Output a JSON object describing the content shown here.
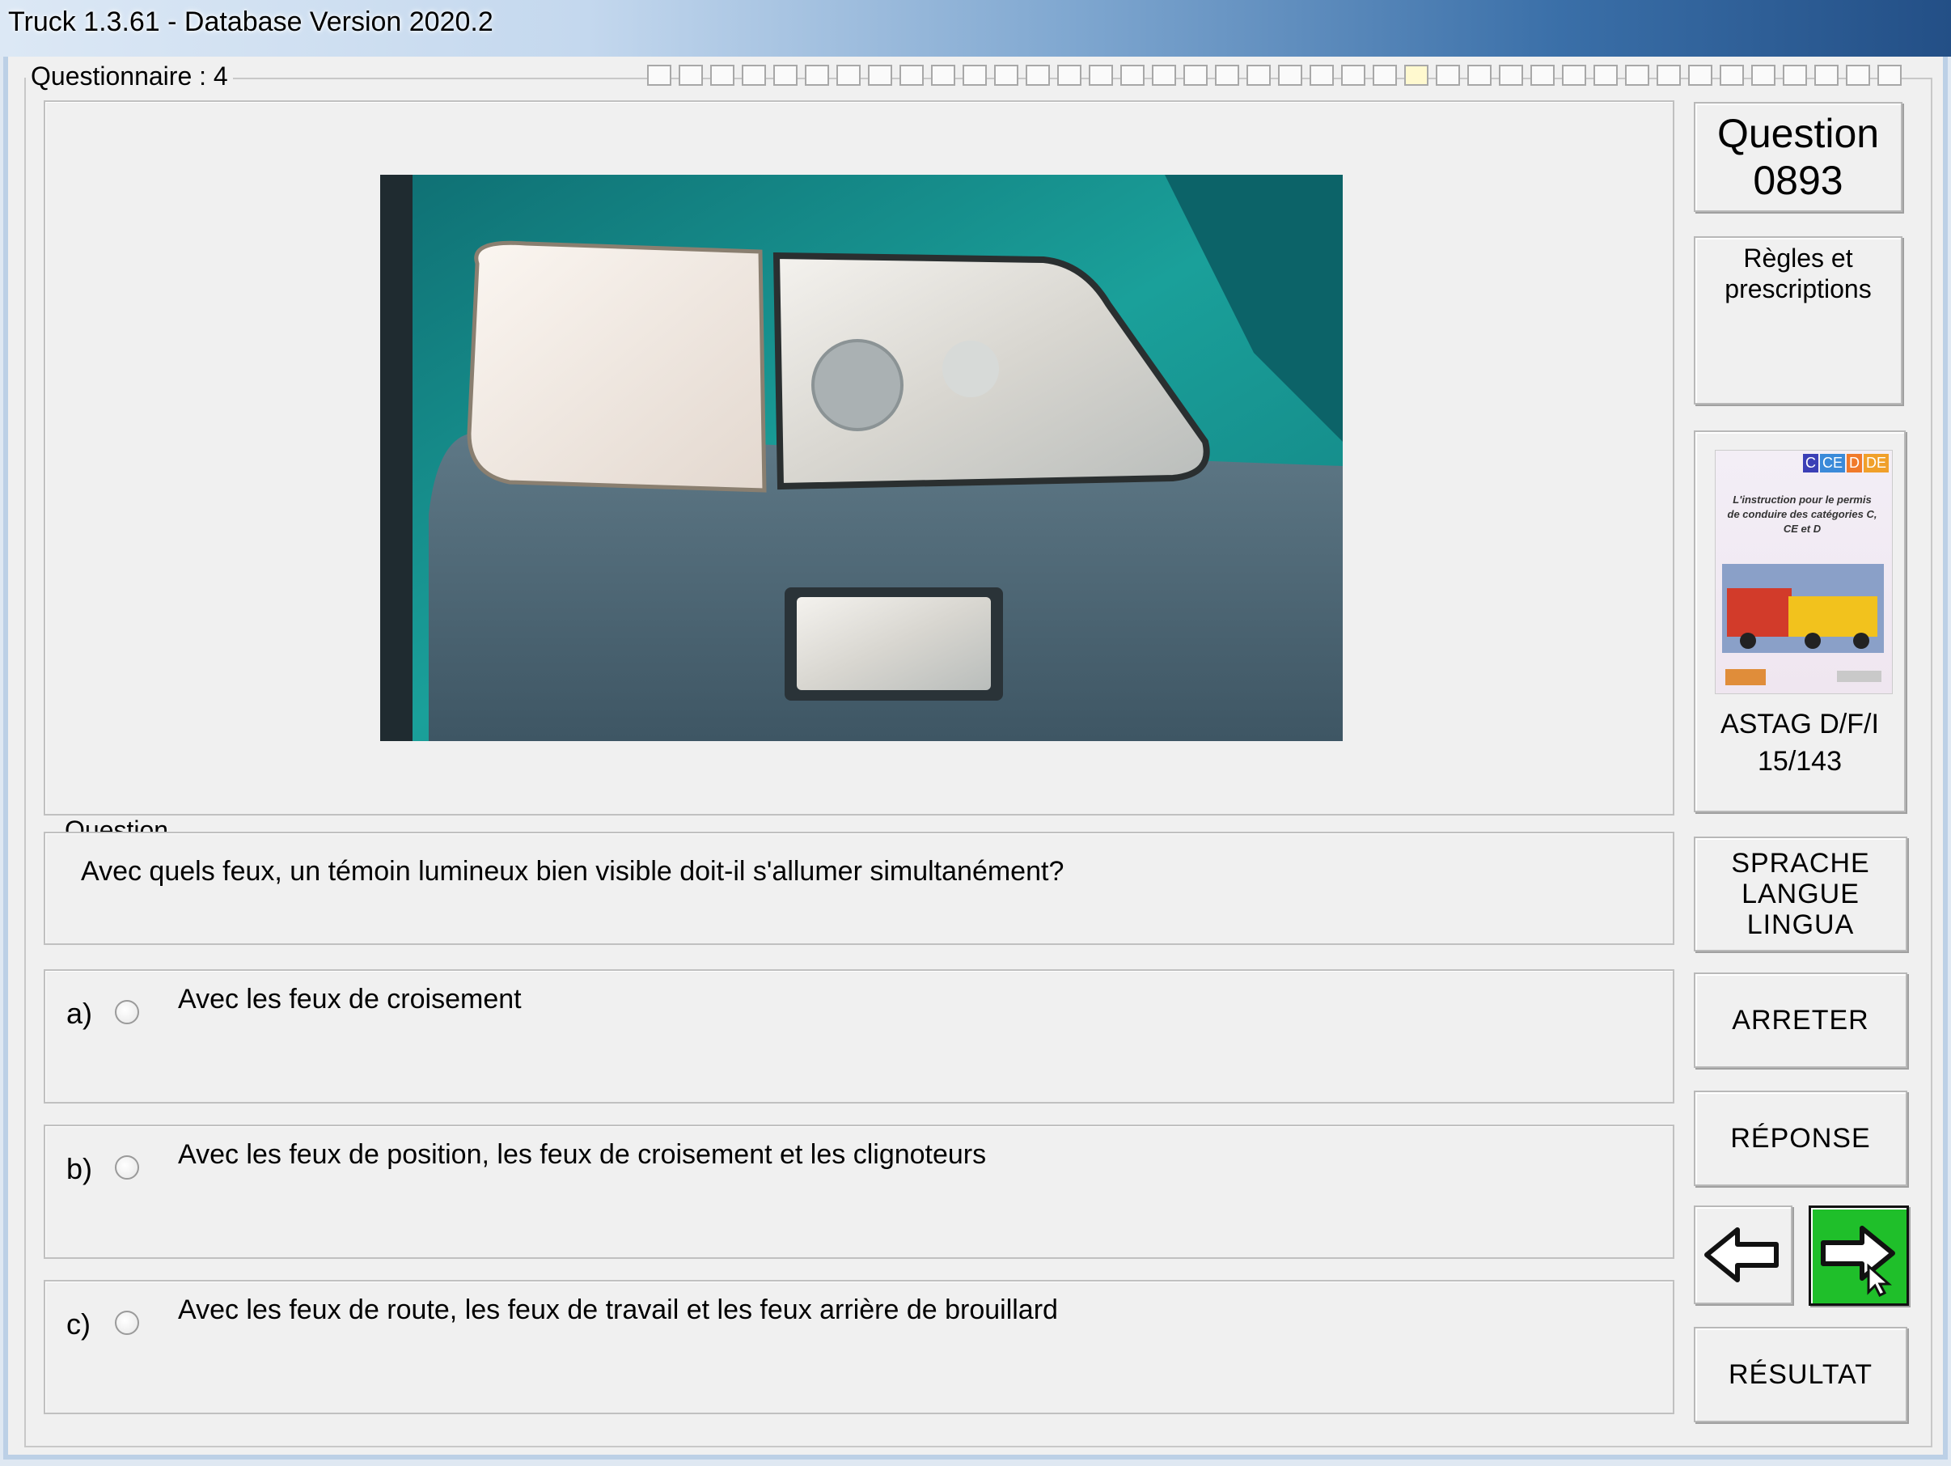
{
  "window": {
    "title": "Truck 1.3.61 - Database Version 2020.2"
  },
  "questionnaire": {
    "label": "Questionnaire : 4",
    "progress_total": 40,
    "progress_current": 25
  },
  "question": {
    "group_label": "Question",
    "text": "Avec quels feux, un témoin lumineux bien visible doit-il s'allumer simultanément?",
    "number_label": "Question",
    "number": "0893",
    "category": "Règles et prescriptions"
  },
  "answers": [
    {
      "letter": "a)",
      "text": "Avec les feux de croisement"
    },
    {
      "letter": "b)",
      "text": "Avec les feux de position, les feux de croisement et les clignoteurs"
    },
    {
      "letter": "c)",
      "text": "Avec les feux de route, les feux de travail et les feux arrière de brouillard"
    }
  ],
  "book": {
    "badges": [
      "C",
      "CE",
      "D",
      "DE"
    ],
    "cover_text": "L'instruction pour le permis de conduire des catégories C, CE et D",
    "source": "ASTAG D/F/I",
    "page": "15/143"
  },
  "buttons": {
    "language": [
      "SPRACHE",
      "LANGUE",
      "LINGUA"
    ],
    "stop": "ARRETER",
    "answer": "RÉPONSE",
    "result": "RÉSULTAT"
  },
  "colors": {
    "next_button": "#1fbf2a",
    "vehicle_body": "#1a8f8a",
    "bumper": "#4f6878"
  },
  "icons": {
    "prev": "arrow-left-icon",
    "next": "arrow-right-icon"
  }
}
